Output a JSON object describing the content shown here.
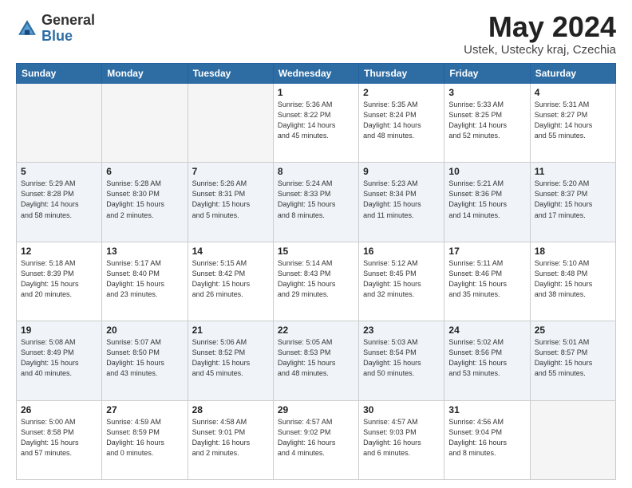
{
  "header": {
    "logo_general": "General",
    "logo_blue": "Blue",
    "title": "May 2024",
    "location": "Ustek, Ustecky kraj, Czechia"
  },
  "weekdays": [
    "Sunday",
    "Monday",
    "Tuesday",
    "Wednesday",
    "Thursday",
    "Friday",
    "Saturday"
  ],
  "weeks": [
    [
      {
        "day": "",
        "info": ""
      },
      {
        "day": "",
        "info": ""
      },
      {
        "day": "",
        "info": ""
      },
      {
        "day": "1",
        "info": "Sunrise: 5:36 AM\nSunset: 8:22 PM\nDaylight: 14 hours\nand 45 minutes."
      },
      {
        "day": "2",
        "info": "Sunrise: 5:35 AM\nSunset: 8:24 PM\nDaylight: 14 hours\nand 48 minutes."
      },
      {
        "day": "3",
        "info": "Sunrise: 5:33 AM\nSunset: 8:25 PM\nDaylight: 14 hours\nand 52 minutes."
      },
      {
        "day": "4",
        "info": "Sunrise: 5:31 AM\nSunset: 8:27 PM\nDaylight: 14 hours\nand 55 minutes."
      }
    ],
    [
      {
        "day": "5",
        "info": "Sunrise: 5:29 AM\nSunset: 8:28 PM\nDaylight: 14 hours\nand 58 minutes."
      },
      {
        "day": "6",
        "info": "Sunrise: 5:28 AM\nSunset: 8:30 PM\nDaylight: 15 hours\nand 2 minutes."
      },
      {
        "day": "7",
        "info": "Sunrise: 5:26 AM\nSunset: 8:31 PM\nDaylight: 15 hours\nand 5 minutes."
      },
      {
        "day": "8",
        "info": "Sunrise: 5:24 AM\nSunset: 8:33 PM\nDaylight: 15 hours\nand 8 minutes."
      },
      {
        "day": "9",
        "info": "Sunrise: 5:23 AM\nSunset: 8:34 PM\nDaylight: 15 hours\nand 11 minutes."
      },
      {
        "day": "10",
        "info": "Sunrise: 5:21 AM\nSunset: 8:36 PM\nDaylight: 15 hours\nand 14 minutes."
      },
      {
        "day": "11",
        "info": "Sunrise: 5:20 AM\nSunset: 8:37 PM\nDaylight: 15 hours\nand 17 minutes."
      }
    ],
    [
      {
        "day": "12",
        "info": "Sunrise: 5:18 AM\nSunset: 8:39 PM\nDaylight: 15 hours\nand 20 minutes."
      },
      {
        "day": "13",
        "info": "Sunrise: 5:17 AM\nSunset: 8:40 PM\nDaylight: 15 hours\nand 23 minutes."
      },
      {
        "day": "14",
        "info": "Sunrise: 5:15 AM\nSunset: 8:42 PM\nDaylight: 15 hours\nand 26 minutes."
      },
      {
        "day": "15",
        "info": "Sunrise: 5:14 AM\nSunset: 8:43 PM\nDaylight: 15 hours\nand 29 minutes."
      },
      {
        "day": "16",
        "info": "Sunrise: 5:12 AM\nSunset: 8:45 PM\nDaylight: 15 hours\nand 32 minutes."
      },
      {
        "day": "17",
        "info": "Sunrise: 5:11 AM\nSunset: 8:46 PM\nDaylight: 15 hours\nand 35 minutes."
      },
      {
        "day": "18",
        "info": "Sunrise: 5:10 AM\nSunset: 8:48 PM\nDaylight: 15 hours\nand 38 minutes."
      }
    ],
    [
      {
        "day": "19",
        "info": "Sunrise: 5:08 AM\nSunset: 8:49 PM\nDaylight: 15 hours\nand 40 minutes."
      },
      {
        "day": "20",
        "info": "Sunrise: 5:07 AM\nSunset: 8:50 PM\nDaylight: 15 hours\nand 43 minutes."
      },
      {
        "day": "21",
        "info": "Sunrise: 5:06 AM\nSunset: 8:52 PM\nDaylight: 15 hours\nand 45 minutes."
      },
      {
        "day": "22",
        "info": "Sunrise: 5:05 AM\nSunset: 8:53 PM\nDaylight: 15 hours\nand 48 minutes."
      },
      {
        "day": "23",
        "info": "Sunrise: 5:03 AM\nSunset: 8:54 PM\nDaylight: 15 hours\nand 50 minutes."
      },
      {
        "day": "24",
        "info": "Sunrise: 5:02 AM\nSunset: 8:56 PM\nDaylight: 15 hours\nand 53 minutes."
      },
      {
        "day": "25",
        "info": "Sunrise: 5:01 AM\nSunset: 8:57 PM\nDaylight: 15 hours\nand 55 minutes."
      }
    ],
    [
      {
        "day": "26",
        "info": "Sunrise: 5:00 AM\nSunset: 8:58 PM\nDaylight: 15 hours\nand 57 minutes."
      },
      {
        "day": "27",
        "info": "Sunrise: 4:59 AM\nSunset: 8:59 PM\nDaylight: 16 hours\nand 0 minutes."
      },
      {
        "day": "28",
        "info": "Sunrise: 4:58 AM\nSunset: 9:01 PM\nDaylight: 16 hours\nand 2 minutes."
      },
      {
        "day": "29",
        "info": "Sunrise: 4:57 AM\nSunset: 9:02 PM\nDaylight: 16 hours\nand 4 minutes."
      },
      {
        "day": "30",
        "info": "Sunrise: 4:57 AM\nSunset: 9:03 PM\nDaylight: 16 hours\nand 6 minutes."
      },
      {
        "day": "31",
        "info": "Sunrise: 4:56 AM\nSunset: 9:04 PM\nDaylight: 16 hours\nand 8 minutes."
      },
      {
        "day": "",
        "info": ""
      }
    ]
  ]
}
